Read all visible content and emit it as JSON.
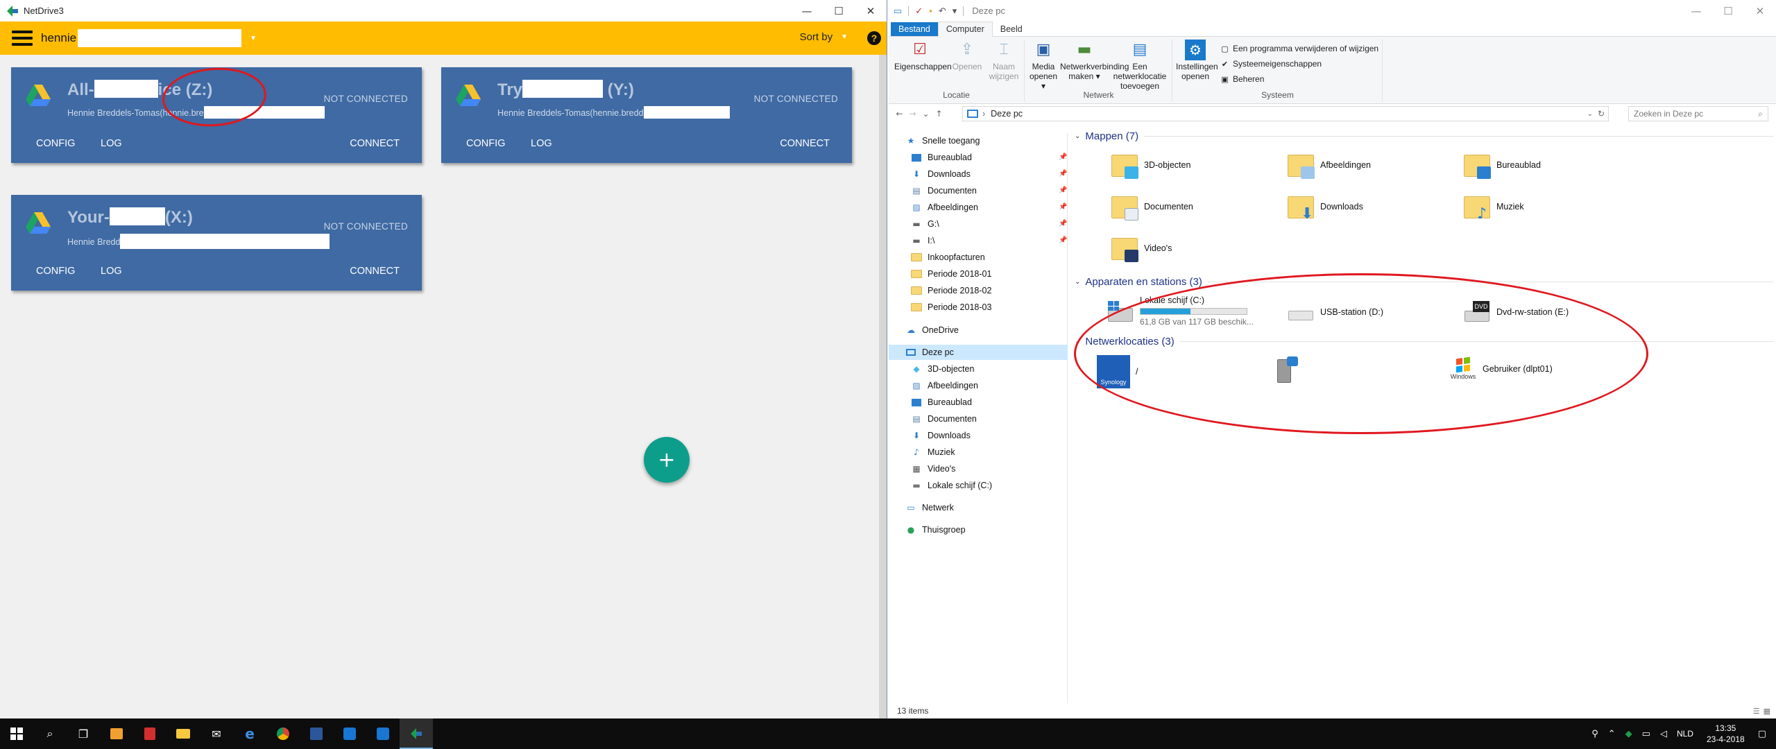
{
  "netdrive": {
    "title": "NetDrive3",
    "account_name": "hennie",
    "sort_label": "Sort by",
    "help_glyph": "?",
    "cards": [
      {
        "name_prefix": "All-",
        "name_suffix": "ice (Z:)",
        "email": "Hennie Breddels-Tomas(hennie.bre",
        "status": "NOT CONNECTED",
        "config": "CONFIG",
        "log": "LOG",
        "connect": "CONNECT"
      },
      {
        "name_prefix": "Try",
        "name_suffix": " (Y:)",
        "email": "Hennie Breddels-Tomas(hennie.bredd",
        "status": "NOT CONNECTED",
        "config": "CONFIG",
        "log": "LOG",
        "connect": "CONNECT"
      },
      {
        "name_prefix": "Your-",
        "name_suffix": "(X:)",
        "email": "Hennie Bredd",
        "status": "NOT CONNECTED",
        "config": "CONFIG",
        "log": "LOG",
        "connect": "CONNECT"
      }
    ],
    "fab_glyph": "+"
  },
  "explorer": {
    "title": "Deze pc",
    "tabs": [
      "Bestand",
      "Computer",
      "Beeld"
    ],
    "ribbon": {
      "locatie": {
        "label": "Locatie",
        "eigenschappen": "Eigenschappen",
        "openen": "Openen",
        "naam_wijzigen": "Naam wijzigen"
      },
      "netwerk": {
        "label": "Netwerk",
        "media_openen": "Media openen",
        "netwerkverbinding": "Netwerkverbinding maken",
        "netwerklocatie": "Een netwerklocatie toevoegen"
      },
      "systeem": {
        "label": "Systeem",
        "instellingen": "Instellingen openen",
        "programma": "Een programma verwijderen of wijzigen",
        "systeemeigenschappen": "Systeemeigenschappen",
        "beheren": "Beheren"
      }
    },
    "address": "Deze pc",
    "search_placeholder": "Zoeken in Deze pc",
    "nav": {
      "snelle_toegang": "Snelle toegang",
      "quick": [
        "Bureaublad",
        "Downloads",
        "Documenten",
        "Afbeeldingen",
        "G:\\",
        "I:\\",
        "Inkoopfacturen",
        "Periode 2018-01",
        "Periode 2018-02",
        "Periode 2018-03"
      ],
      "onedrive": "OneDrive",
      "deze_pc": "Deze pc",
      "pc_items": [
        "3D-objecten",
        "Afbeeldingen",
        "Bureaublad",
        "Documenten",
        "Downloads",
        "Muziek",
        "Video's",
        "Lokale schijf (C:)"
      ],
      "netwerk": "Netwerk",
      "thuisgroep": "Thuisgroep"
    },
    "groups": {
      "mappen": "Mappen (7)",
      "apparaten": "Apparaten en stations (3)",
      "netwerklocaties": "Netwerklocaties (3)"
    },
    "folders": [
      "3D-objecten",
      "Afbeeldingen",
      "Bureaublad",
      "Documenten",
      "Downloads",
      "Muziek",
      "Video's"
    ],
    "drives": {
      "c": {
        "name": "Lokale schijf (C:)",
        "free": "61,8 GB van 117 GB beschik...",
        "used_fraction": 0.47
      },
      "d": "USB-station (D:)",
      "e": "Dvd-rw-station (E:)",
      "dvd_badge": "DVD"
    },
    "netlocs": {
      "synology": "/",
      "synology_badge": "Synology",
      "gebruiker": "Gebruiker (dlpt01)",
      "windows_label": "Windows"
    },
    "status": "13 items"
  },
  "taskbar": {
    "lang": "NLD",
    "time": "13:35",
    "date": "23-4-2018"
  },
  "colors": {
    "netdrive_toolbar": "#ffbc00",
    "card_bg": "#3f6aa3",
    "fab": "#0d9e8b",
    "annotation_red": "#e0181f",
    "explorer_accent": "#1979ca"
  }
}
